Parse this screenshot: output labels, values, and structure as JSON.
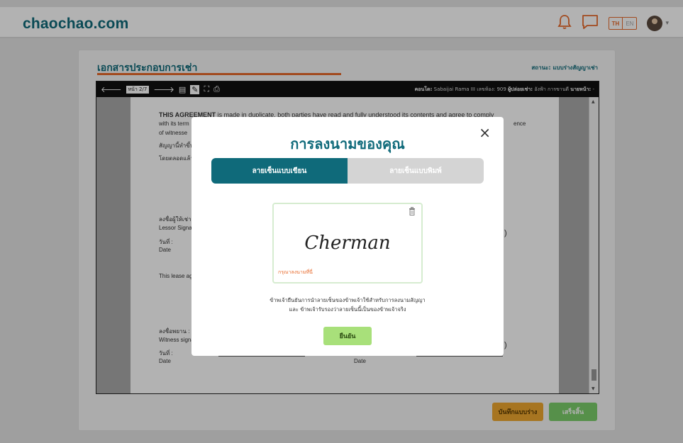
{
  "header": {
    "brand": "chaochao.com",
    "icons": [
      "bell-icon",
      "chat-icon"
    ],
    "lang_active": "TH",
    "lang_inactive": "EN"
  },
  "card": {
    "title": "เอกสารประกอบการเช่า",
    "status": "สถานะ: แบบร่างสัญญาเช่า"
  },
  "viewer": {
    "page_indicator": "หน้า 2/7",
    "info_label1": "คอนโด:",
    "info_value1": "Sabaijai Rama III เลขห้อง: 909",
    "info_label2": "ผู้ปล่อยเช่า:",
    "info_value2": "อังฟ้า การขานดี",
    "info_label3": "นายหน้า:",
    "info_value3": "-"
  },
  "document": {
    "para_bold": "THIS AGREEMENT",
    "para_rest": " is made in duplicate, both parties have read and fully understood its contents and agree to comply",
    "line2": "with its term",
    "line2_end": "ence",
    "line3": "of witnesse",
    "line4": "สัญญานี้ทำขึ้น",
    "line5": "โดยตลอดแล้ว",
    "lessor_th": "ลงชื่อผู้ให้เช่า :",
    "lessor_en": "Lessor Signat",
    "date_th1": "วันที่ :",
    "date_en1": "Date",
    "lease_line": "This lease ag",
    "witness_th": "ลงชื่อพยาน :",
    "witness_en": "Witness signa",
    "date_th2": "วันที่ :",
    "date_en2": "Date",
    "date_th3": "วันที่ :",
    "date_en3": "Date",
    "paren1": ")",
    "paren2": ")"
  },
  "actions": {
    "draft": "บันทึกแบบร่าง",
    "finish": "เสร็จสิ้น"
  },
  "modal": {
    "title": "การลงนามของคุณ",
    "close": "×",
    "tab_write": "ลายเซ็นแบบเขียน",
    "tab_type": "ลายเซ็นแบบพิมพ์",
    "signature": "Cherman",
    "hint": "กรุณาลงนามที่นี่",
    "consent1": "ข้าพเจ้ายืนยันการนำลายเซ็นของข้าพเจ้าใช้สำหรับการลงนามสัญญา",
    "consent2": "และ ข้าพเจ้ารับรองว่าลายเซ็นนี้เป็นของข้าพเจ้าจริง",
    "confirm": "ยืนยัน"
  },
  "colors": {
    "brand": "#0f6a7a",
    "accent": "#e86a2b",
    "draft": "#f0a830",
    "finish": "#7ccf6a",
    "confirm": "#a8e07a"
  }
}
